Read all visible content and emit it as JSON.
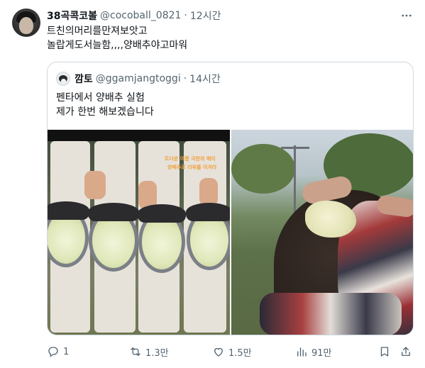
{
  "tweet": {
    "display_name": "38곡콕코볼",
    "handle": "@cocoball_0821",
    "separator": "·",
    "time": "12시간",
    "lines": [
      "트친의머리를만져보앗고",
      "놀랍게도서늘함,,,,양배추야고마워"
    ]
  },
  "quoted": {
    "display_name": "깜토",
    "handle": "@ggamjangtoggi",
    "separator": "·",
    "time": "14시간",
    "lines": [
      "펜타에서 양배추 실험",
      "제가 한번 해보겠습니다"
    ],
    "images": [
      {
        "icon": "baseball-caps-with-cabbage-photo",
        "caption_lines": [
          "트다운 여름 극한의 배이",
          "양배추로 더위를 이겨라"
        ]
      },
      {
        "icon": "cabbage-leaf-on-head-photo"
      }
    ]
  },
  "actions": {
    "reply": {
      "icon": "reply-icon",
      "count": "1"
    },
    "retweet": {
      "icon": "retweet-icon",
      "count": "1.3만"
    },
    "like": {
      "icon": "heart-icon",
      "count": "1.5만"
    },
    "views": {
      "icon": "views-icon",
      "count": "91만"
    },
    "bookmark": {
      "icon": "bookmark-icon"
    },
    "share": {
      "icon": "share-icon"
    }
  },
  "colors": {
    "text_primary": "#0f1419",
    "text_secondary": "#536471",
    "border": "#cfd9de",
    "caption_orange": "#f2a03d"
  }
}
